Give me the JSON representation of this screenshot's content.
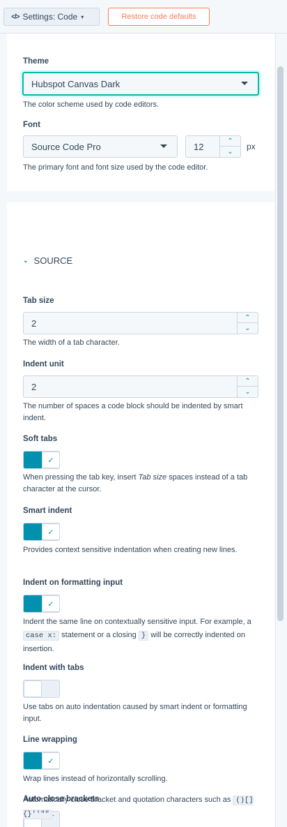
{
  "topbar": {
    "menu_icon": "</>",
    "menu_label": "Settings: Code",
    "menu_caret": "▾",
    "restore_label": "Restore code defaults"
  },
  "theme": {
    "label": "Theme",
    "value": "Hubspot Canvas Dark",
    "help": "The color scheme used by code editors."
  },
  "font": {
    "label": "Font",
    "value": "Source Code Pro",
    "size": "12",
    "unit": "px",
    "help": "The primary font and font size used by the code editor."
  },
  "source": {
    "chevron": "⌄",
    "title": "SOURCE",
    "tab_size": {
      "label": "Tab size",
      "value": "2",
      "help": "The width of a tab character."
    },
    "indent_unit": {
      "label": "Indent unit",
      "value": "2",
      "help": "The number of spaces a code block should be indented by smart indent."
    },
    "soft_tabs": {
      "label": "Soft tabs",
      "enabled": true,
      "help_pre": "When pressing the tab key, insert ",
      "help_em": "Tab size",
      "help_post": " spaces instead of a tab character at the cursor."
    },
    "smart_indent": {
      "label": "Smart indent",
      "enabled": true,
      "help": "Provides context sensitive indentation when creating new lines."
    },
    "indent_formatting": {
      "label": "Indent on formatting input",
      "enabled": true,
      "help_pre": "Indent the same line on contextually sensitive input. For example, a ",
      "code1": "case x:",
      "help_mid": " statement or a closing ",
      "code2": "}",
      "help_post": " will be correctly indented on insertion."
    },
    "indent_tabs": {
      "label": "Indent with tabs",
      "enabled": false,
      "help": "Use tabs on auto indentation caused by smart indent or formatting input."
    },
    "line_wrapping": {
      "label": "Line wrapping",
      "enabled": true,
      "help": "Wrap lines instead of horizontally scrolling."
    },
    "auto_close": {
      "label": "Auto close brackets",
      "enabled": false,
      "help_pre": "Automatically close bracket and quotation characters such as ",
      "code": "()[]{}''\"\"",
      "help_post": "."
    }
  },
  "icons": {
    "check": "✓",
    "up": "⌃",
    "down": "⌄"
  },
  "colors": {
    "accent": "#0091ae",
    "restore": "#ff7a59",
    "focus": "#00bda5"
  }
}
